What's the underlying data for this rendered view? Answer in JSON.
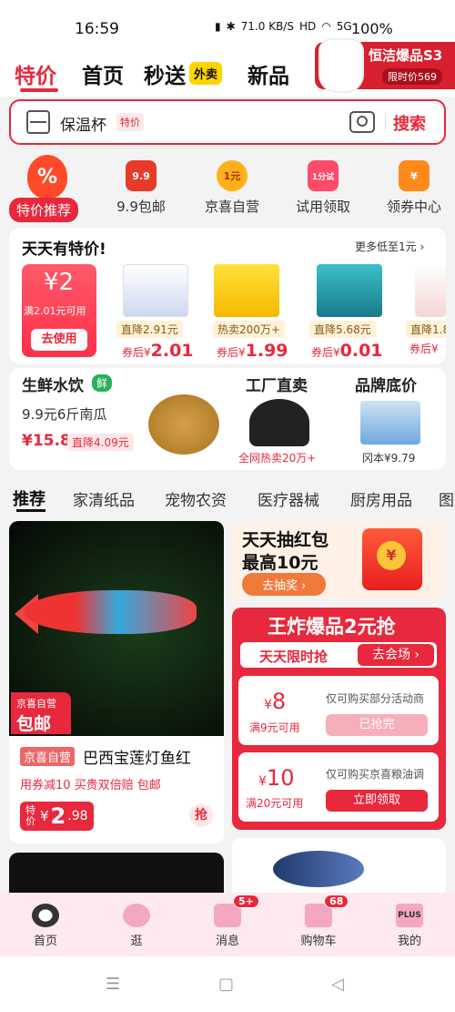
{
  "status": {
    "time": "16:59",
    "net": "71.0 KB/S",
    "hd": "HD",
    "signal": "5G",
    "battery": "100%"
  },
  "top_nav": {
    "tabs": [
      "特价",
      "首页",
      "秒送",
      "新品"
    ],
    "waimai": "外卖"
  },
  "ad": {
    "title": "恒洁爆品S3",
    "price": "限时价569"
  },
  "search": {
    "value": "保温杯",
    "tag": "特价",
    "button": "搜索"
  },
  "categories": [
    {
      "label": "特价推荐",
      "icon": "%"
    },
    {
      "label": "9.9包邮",
      "icon": "9.9"
    },
    {
      "label": "京喜自营",
      "icon": "1元"
    },
    {
      "label": "试用领取",
      "icon": "1分试"
    },
    {
      "label": "领券中心",
      "icon": "¥"
    }
  ],
  "daily": {
    "title": "天天有特价!",
    "more": "更多低至1元 ›",
    "coupon": {
      "amount": "¥2",
      "cond": "满2.01元可用",
      "btn": "去使用"
    },
    "products": [
      {
        "tag": "直降2.91元",
        "prefix": "券后¥",
        "price": "2.01"
      },
      {
        "tag": "热卖200万+",
        "prefix": "券后¥",
        "price": "1.99"
      },
      {
        "tag": "直降5.68元",
        "prefix": "券后¥",
        "price": "0.01"
      },
      {
        "tag": "直降1.8",
        "prefix": "券后¥",
        "price": ""
      }
    ]
  },
  "row2": {
    "fresh": {
      "title": "生鲜水饮",
      "tag": "鲜",
      "sub": "9.9元6斤南瓜",
      "price": "¥15.8",
      "drop": "直降4.09元"
    },
    "factory": {
      "title": "工厂直卖",
      "sub": "全网热卖20万+"
    },
    "brand": {
      "title": "品牌底价",
      "sub": "冈本¥9.79"
    }
  },
  "tabs": [
    "推荐",
    "家清纸品",
    "宠物农资",
    "医疗器械",
    "厨房用品",
    "图"
  ],
  "card1": {
    "badge1": "京喜自营",
    "badge2": "包邮",
    "tag": "京喜自营",
    "title": "巴西宝莲灯鱼红",
    "promo": "用券减10 买贵双倍赔 包邮",
    "price_label": "特价",
    "price_symbol": "¥",
    "price_int": "2",
    "price_dec": ".98",
    "grab": "抢"
  },
  "hongbao": {
    "line1": "天天抽红包",
    "line2": "最高10元",
    "btn": "去抽奖 ›"
  },
  "bomb": {
    "title": "王炸爆品2元抢",
    "limit": "天天限时抢",
    "go": "去会场 ›",
    "coupons": [
      {
        "amount": "8",
        "cond": "满9元可用",
        "desc": "仅可购买部分活动商",
        "btn": "已抢完"
      },
      {
        "amount": "10",
        "cond": "满20元可用",
        "desc": "仅可购买京喜粮油调",
        "btn": "立即领取"
      }
    ]
  },
  "bottom_nav": [
    {
      "label": "首页",
      "badge": ""
    },
    {
      "label": "逛",
      "badge": ""
    },
    {
      "label": "消息",
      "badge": "5+"
    },
    {
      "label": "购物车",
      "badge": "68"
    },
    {
      "label": "我的",
      "badge": "",
      "icon": "PLUS"
    }
  ],
  "colors": {
    "accent": "#e8283c"
  }
}
